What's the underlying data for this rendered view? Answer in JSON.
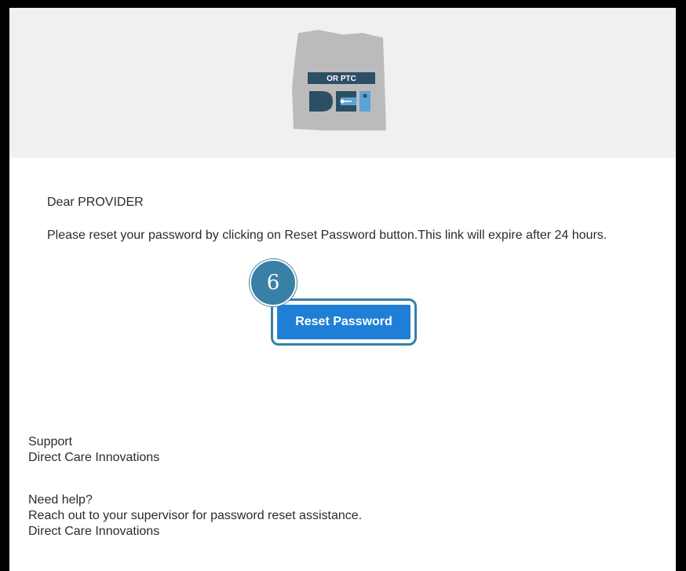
{
  "logo": {
    "badge_text": "OR PTC",
    "brand_text": "DCI",
    "colors": {
      "map_gray": "#a9a9a9",
      "navy": "#2d4f66",
      "accent_blue": "#5ba4d6"
    }
  },
  "email": {
    "greeting": "Dear PROVIDER",
    "message": "Please reset your password by clicking on Reset Password button.This link will expire after 24 hours.",
    "button_label": "Reset Password",
    "step_number": "6",
    "support_title": "Support",
    "support_company": "Direct Care Innovations",
    "help_title": "Need help?",
    "help_text": "Reach out to your supervisor for password reset assistance.",
    "help_company": "Direct Care Innovations"
  },
  "colors": {
    "button": "#1f7fd6",
    "highlight": "#3a7fa6",
    "header_bg": "#eef0f2"
  }
}
